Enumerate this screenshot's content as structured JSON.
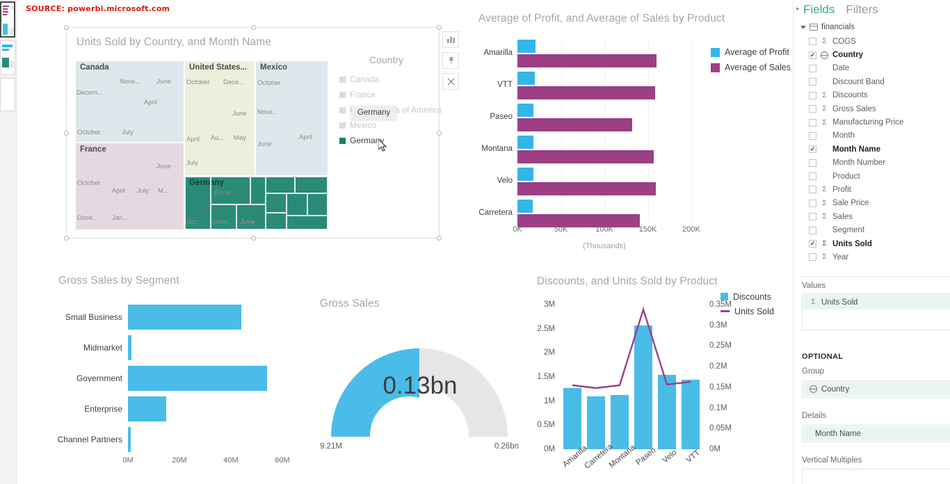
{
  "source_note": "SOURCE: powerbi.microsoft.com",
  "left_rail": {
    "thumbnails": [
      "page-thumbnail-1",
      "page-thumbnail-2",
      "page-thumbnail-3"
    ]
  },
  "treemap": {
    "title": "Units Sold by Country, and Month Name",
    "legend_title": "Country",
    "legend_items": [
      {
        "label": "Canada",
        "active": false
      },
      {
        "label": "France",
        "active": false
      },
      {
        "label": "United States of America",
        "active": false
      },
      {
        "label": "Mexico",
        "active": false
      },
      {
        "label": "Germany",
        "active": true
      }
    ],
    "tooltip": "Germany",
    "blocks": [
      {
        "country": "Canada",
        "color": "#dde7ec",
        "months": [
          "Nove...",
          "June",
          "Decem...",
          "April",
          "October",
          "July"
        ]
      },
      {
        "country": "United States...",
        "color": "#eeeedd",
        "months": [
          "October",
          "Dece...",
          "June",
          "April",
          "Au...",
          "May",
          "July"
        ]
      },
      {
        "country": "Mexico",
        "color": "#dde7ec",
        "months": [
          "October",
          "Nove...",
          "April",
          "June"
        ]
      },
      {
        "country": "France",
        "color": "#e4d9e0",
        "months": [
          "June",
          "October",
          "April",
          "July",
          "M...",
          "Dece...",
          "Jan..."
        ]
      },
      {
        "country": "Germany",
        "color": "#2a8a78",
        "months": [
          "Dece...",
          "Oct...",
          "Nove...",
          "June"
        ]
      }
    ]
  },
  "visual_header": {
    "buttons": [
      {
        "name": "focus-mode-icon",
        "label": "focus-mode"
      },
      {
        "name": "pin-visual-icon",
        "label": "pin"
      },
      {
        "name": "remove-filter-icon",
        "label": "remove"
      }
    ]
  },
  "bar_chart": {
    "title": "Average of Profit, and Average of Sales by Product",
    "legend": [
      {
        "label": "Average of Profit",
        "color": "#34b6e8"
      },
      {
        "label": "Average of Sales",
        "color": "#9c3f85"
      }
    ]
  },
  "segment_chart": {
    "title": "Gross Sales by Segment"
  },
  "gauge": {
    "title": "Gross Sales",
    "value_label": "0.13bn",
    "min_label": "9.21M",
    "max_label": "0.26bn"
  },
  "combo_chart": {
    "title": "Discounts, and Units Sold by Product",
    "legend": [
      {
        "label": "Discounts",
        "color": "#49bce8",
        "type": "bar"
      },
      {
        "label": "Units Sold",
        "color": "#9c3f85",
        "type": "line"
      }
    ]
  },
  "right_pane": {
    "collapse_icon": "chevron-right-icon",
    "tabs": [
      {
        "label": "Fields",
        "active": true
      },
      {
        "label": "Filters",
        "active": false
      }
    ],
    "table_name": "financials",
    "fields": [
      {
        "label": "COGS",
        "checked": false,
        "icon": "sigma"
      },
      {
        "label": "Country",
        "checked": true,
        "icon": "globe"
      },
      {
        "label": "Date",
        "checked": false,
        "icon": "none"
      },
      {
        "label": "Discount Band",
        "checked": false,
        "icon": "none"
      },
      {
        "label": "Discounts",
        "checked": false,
        "icon": "sigma"
      },
      {
        "label": "Gross Sales",
        "checked": false,
        "icon": "sigma"
      },
      {
        "label": "Manufacturing Price",
        "checked": false,
        "icon": "sigma"
      },
      {
        "label": "Month",
        "checked": false,
        "icon": "none"
      },
      {
        "label": "Month Name",
        "checked": true,
        "icon": "none"
      },
      {
        "label": "Month Number",
        "checked": false,
        "icon": "none"
      },
      {
        "label": "Product",
        "checked": false,
        "icon": "none"
      },
      {
        "label": "Profit",
        "checked": false,
        "icon": "sigma"
      },
      {
        "label": "Sale Price",
        "checked": false,
        "icon": "sigma"
      },
      {
        "label": "Sales",
        "checked": false,
        "icon": "sigma"
      },
      {
        "label": "Segment",
        "checked": false,
        "icon": "none"
      },
      {
        "label": "Units Sold",
        "checked": true,
        "icon": "sigma"
      },
      {
        "label": "Year",
        "checked": false,
        "icon": "sigma"
      }
    ],
    "wells": {
      "values_label": "Values",
      "values_chip": "Units Sold",
      "values_chip_icon": "sigma",
      "optional_label": "OPTIONAL",
      "group_label": "Group",
      "group_chip": "Country",
      "group_chip_icon": "globe",
      "details_label": "Details",
      "details_chip": "Month Name",
      "vertical_multiples_label": "Vertical Multiples"
    }
  },
  "chart_data": [
    {
      "type": "treemap",
      "title": "Units Sold by Country, and Month Name",
      "group": "Country",
      "detail": "Month Name",
      "value": "Units Sold",
      "categories": [
        "Canada",
        "United States of America",
        "Mexico",
        "France",
        "Germany"
      ],
      "legend_position": "right",
      "highlighted": "Germany"
    },
    {
      "type": "bar",
      "title": "Average of Profit, and Average of Sales by Product",
      "orientation": "horizontal",
      "categories": [
        "Amarilla",
        "VTT",
        "Paseo",
        "Montana",
        "Velo",
        "Carretera"
      ],
      "series": [
        {
          "name": "Average of Profit",
          "color": "#34b6e8",
          "values": [
            21000,
            20000,
            18500,
            18000,
            18500,
            17500
          ]
        },
        {
          "name": "Average of Sales",
          "color": "#9c3f85",
          "values": [
            160000,
            158000,
            132000,
            157000,
            159000,
            141000
          ]
        }
      ],
      "xlabel": "(Thousands)",
      "ylabel": "",
      "xticks": [
        "0K",
        "50K",
        "100K",
        "150K",
        "200K"
      ],
      "xlim": [
        0,
        200000
      ],
      "grid": true,
      "legend_position": "right"
    },
    {
      "type": "bar",
      "title": "Gross Sales by Segment",
      "orientation": "horizontal",
      "categories": [
        "Small Business",
        "Midmarket",
        "Government",
        "Enterprise",
        "Channel Partners"
      ],
      "values": [
        42000000,
        1200000,
        53000000,
        14000000,
        900000
      ],
      "color": "#49bce8",
      "xticks": [
        "0M",
        "20M",
        "40M",
        "60M"
      ],
      "xlim": [
        0,
        64000000
      ],
      "xlabel": "",
      "ylabel": ""
    },
    {
      "type": "gauge",
      "title": "Gross Sales",
      "value": 0.13,
      "value_label": "0.13bn",
      "min": 9.21,
      "min_label": "9.21M",
      "max": 0.26,
      "max_label": "0.26bn",
      "percent_filled": 50,
      "color": "#49bce8",
      "track_color": "#e6e6e6"
    },
    {
      "type": "line",
      "title": "Discounts, and Units Sold by Product",
      "categories": [
        "Amarilla",
        "Carretera",
        "Montana",
        "Paseo",
        "Velo",
        "VTT"
      ],
      "series": [
        {
          "name": "Discounts",
          "type": "bar",
          "color": "#49bce8",
          "axis": "left",
          "values": [
            1270000,
            1090000,
            1130000,
            2570000,
            1550000,
            1440000
          ]
        },
        {
          "name": "Units Sold",
          "type": "line",
          "color": "#9c3f85",
          "axis": "right",
          "values": [
            155000,
            148000,
            155000,
            338000,
            157000,
            163000
          ]
        }
      ],
      "yticks": [
        "0M",
        "0.5M",
        "1M",
        "1.5M",
        "2M",
        "2.5M",
        "3M"
      ],
      "ylim": [
        0,
        3000000
      ],
      "y2ticks": [
        "0M",
        "0.05M",
        "0.1M",
        "0.15M",
        "0.2M",
        "0.25M",
        "0.3M",
        "0.35M"
      ],
      "y2lim": [
        0,
        350000
      ],
      "legend_position": "right",
      "grid": false
    }
  ]
}
